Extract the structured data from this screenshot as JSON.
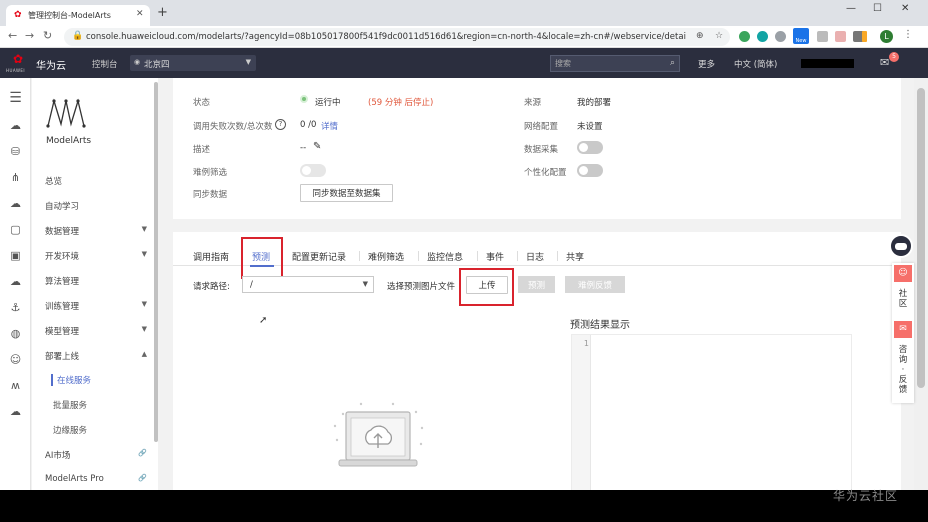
{
  "browser": {
    "tab_title": "管理控制台-ModelArts",
    "url": "console.huaweicloud.com/modelarts/?agencyId=08b105017800f541f9dc0011d516d61&region=cn-north-4&locale=zh-cn#/webservice/detail/re...",
    "new_badge": "New",
    "profile_initial": "L"
  },
  "header": {
    "brand": "华为云",
    "logo_text": "HUAWEI",
    "console_label": "控制台",
    "region": "北京四",
    "search_placeholder": "搜索",
    "more": "更多",
    "language": "中文 (简体)",
    "notif_count": "5"
  },
  "sidebar": {
    "product_name": "ModelArts",
    "items": [
      {
        "label": "总览"
      },
      {
        "label": "自动学习"
      },
      {
        "label": "数据管理"
      },
      {
        "label": "开发环境"
      },
      {
        "label": "算法管理"
      },
      {
        "label": "训练管理"
      },
      {
        "label": "模型管理"
      },
      {
        "label": "部署上线"
      }
    ],
    "subitems": [
      {
        "label": "在线服务"
      },
      {
        "label": "批量服务"
      },
      {
        "label": "边缘服务"
      }
    ],
    "extra": [
      {
        "label": "AI市场"
      },
      {
        "label": "ModelArts Pro"
      }
    ]
  },
  "details": {
    "status_label": "状态",
    "status_value": "运行中",
    "status_note": "(59 分钟 后停止)",
    "calls_label": "调用失败次数/总次数",
    "calls_value": "0 /0",
    "calls_link": "详情",
    "desc_label": "描述",
    "desc_value": "--",
    "filter_label": "难例筛选",
    "sync_label": "同步数据",
    "sync_button": "同步数据至数据集",
    "source_label": "来源",
    "source_value": "我的部署",
    "network_label": "网络配置",
    "network_value": "未设置",
    "collect_label": "数据采集",
    "personal_label": "个性化配置"
  },
  "tabs": [
    {
      "label": "调用指南"
    },
    {
      "label": "预测"
    },
    {
      "label": "配置更新记录"
    },
    {
      "label": "难例筛选"
    },
    {
      "label": "监控信息"
    },
    {
      "label": "事件"
    },
    {
      "label": "日志"
    },
    {
      "label": "共享"
    }
  ],
  "predict": {
    "path_label": "请求路径:",
    "path_value": "/",
    "file_label": "选择预测图片文件",
    "upload_button": "上传",
    "predict_button": "预测",
    "hard_button": "难例反馈",
    "result_title": "预测结果显示",
    "line_number": "1"
  },
  "float_widget": {
    "community": "社区",
    "feedback": "咨询·反馈"
  },
  "watermark": "华为云社区"
}
